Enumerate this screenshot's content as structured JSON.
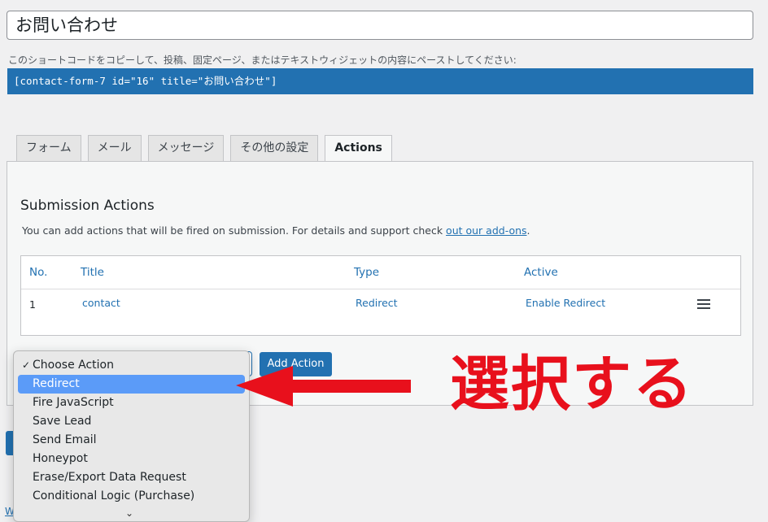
{
  "form": {
    "title": "お問い合わせ",
    "shortcode_desc": "このショートコードをコピーして、投稿、固定ページ、またはテキストウィジェットの内容にペーストしてください:",
    "shortcode": "[contact-form-7 id=\"16\" title=\"お問い合わせ\"]"
  },
  "tabs": [
    {
      "label": "フォーム",
      "active": false
    },
    {
      "label": "メール",
      "active": false
    },
    {
      "label": "メッセージ",
      "active": false
    },
    {
      "label": "その他の設定",
      "active": false
    },
    {
      "label": "Actions",
      "active": true
    }
  ],
  "panel": {
    "heading": "Submission Actions",
    "desc_text": "You can add actions that will be fired on submission. For details and support check ",
    "desc_link": "out our add-ons",
    "desc_end": "."
  },
  "table": {
    "headers": {
      "no": "No.",
      "title": "Title",
      "type": "Type",
      "active": "Active"
    },
    "rows": [
      {
        "no": "1",
        "title": "contact",
        "type": "Redirect",
        "active": "Enable Redirect"
      }
    ]
  },
  "add_button_label": "Add Action",
  "dropdown": {
    "check_mark": "✓",
    "scroll_icon": "⌄",
    "options": [
      {
        "label": "Choose Action",
        "checked": true,
        "highlighted": false
      },
      {
        "label": "Redirect",
        "checked": false,
        "highlighted": true
      },
      {
        "label": "Fire JavaScript",
        "checked": false,
        "highlighted": false
      },
      {
        "label": "Save Lead",
        "checked": false,
        "highlighted": false
      },
      {
        "label": "Send Email",
        "checked": false,
        "highlighted": false
      },
      {
        "label": "Honeypot",
        "checked": false,
        "highlighted": false
      },
      {
        "label": "Erase/Export Data Request",
        "checked": false,
        "highlighted": false
      },
      {
        "label": "Conditional Logic (Purchase)",
        "checked": false,
        "highlighted": false
      }
    ]
  },
  "footer_stub": "W",
  "annotation": {
    "label": "選択する",
    "color": "#e8101c"
  }
}
